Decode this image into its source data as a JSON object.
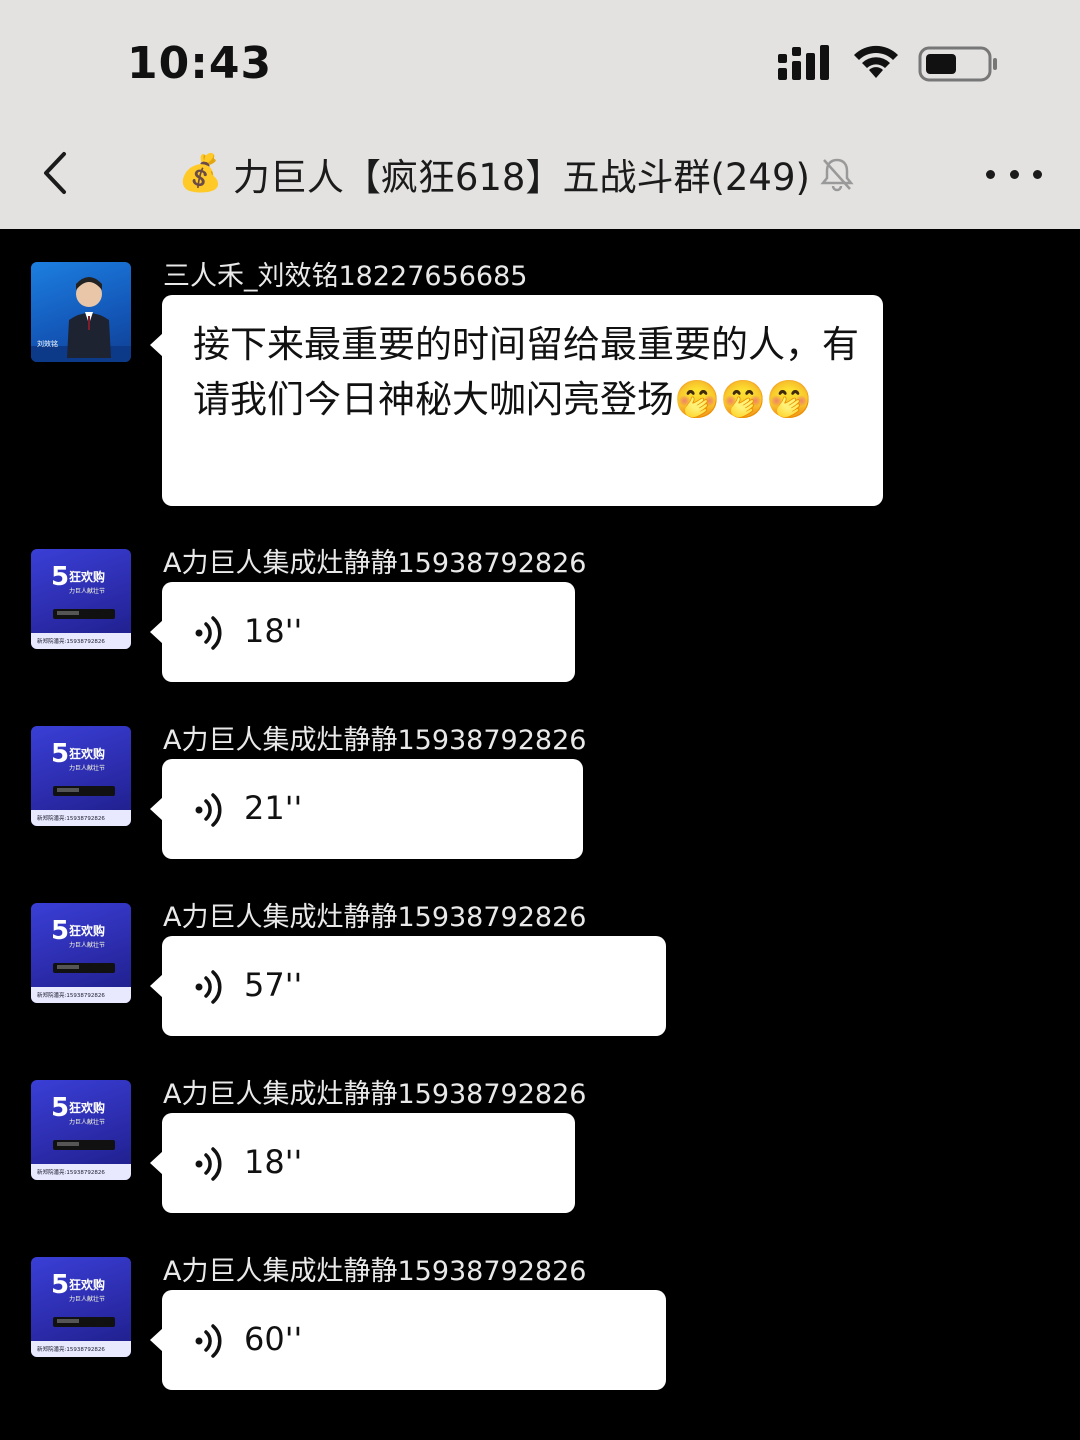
{
  "status_bar": {
    "time": "10:43"
  },
  "header": {
    "title_emoji": "💰",
    "title": "力巨人【疯狂618】五战斗群(249)"
  },
  "messages": [
    {
      "sender": "三人禾_刘效铭18227656685",
      "text": "接下来最重要的时间留给最重要的人，有请我们今日神秘大咖闪亮登场🤭🤭🤭"
    },
    {
      "sender": "A力巨人集成灶静静15938792826",
      "voice_duration": "18''"
    },
    {
      "sender": "A力巨人集成灶静静15938792826",
      "voice_duration": "21''"
    },
    {
      "sender": "A力巨人集成灶静静15938792826",
      "voice_duration": "57''"
    },
    {
      "sender": "A力巨人集成灶静静15938792826",
      "voice_duration": "18''"
    },
    {
      "sender": "A力巨人集成灶静静15938792826",
      "voice_duration": "60''"
    }
  ],
  "avatar_promo": {
    "headline": "5",
    "headline_text": "狂欢购",
    "subline": "力巨人献壮节",
    "footer": "新郑院潘亮:15938792826"
  },
  "avatar_person": {
    "caption": "刘效铭"
  }
}
